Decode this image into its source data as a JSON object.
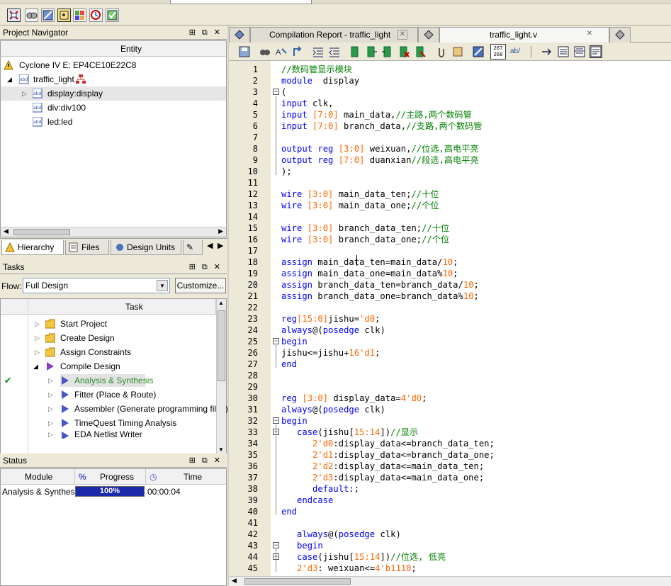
{
  "toolbar": {
    "icons": [
      "netlist-viewer-icon",
      "technology-map-icon",
      "chip-planner-icon",
      "pin-planner-icon",
      "design-assistant-icon",
      "timing-analyzer-icon",
      "programmer-icon"
    ]
  },
  "navigator": {
    "title": "Project Navigator",
    "column": "Entity",
    "device": "Cyclone IV E: EP4CE10E22C8",
    "items": [
      {
        "label": "traffic_light"
      },
      {
        "label": "display:display"
      },
      {
        "label": "div:div100"
      },
      {
        "label": "led:led"
      }
    ],
    "tabs": [
      "Hierarchy",
      "Files",
      "Design Units"
    ]
  },
  "tasks": {
    "title": "Tasks",
    "flow_label": "Flow:",
    "flow_value": "Full Design",
    "customize": "Customize...",
    "column": "Task",
    "items": [
      {
        "label": "Start Project"
      },
      {
        "label": "Create Design"
      },
      {
        "label": "Assign Constraints"
      },
      {
        "label": "Compile Design"
      },
      {
        "label": "Analysis & Synthesis"
      },
      {
        "label": "Fitter (Place & Route)"
      },
      {
        "label": "Assembler (Generate programming files)"
      },
      {
        "label": "TimeQuest Timing Analysis"
      },
      {
        "label": "EDA Netlist Writer"
      }
    ]
  },
  "status": {
    "title": "Status",
    "columns": {
      "module": "Module",
      "pct": "%",
      "progress": "Progress",
      "time": "Time"
    },
    "row": {
      "module": "Analysis & Synthesis",
      "progress_text": "100%",
      "progress": 1.0,
      "time": "00:00:04"
    }
  },
  "editor": {
    "tabs": [
      {
        "label": "Compilation Report - traffic_light"
      },
      {
        "label": "traffic_light.v"
      }
    ],
    "badge_top": "267",
    "badge_bottom": "268",
    "abc": "ab/"
  },
  "code": [
    {
      "n": "1",
      "t": [
        [
          "cm",
          "//数码管显示模块"
        ]
      ]
    },
    {
      "n": "2",
      "t": [
        [
          "kw",
          "module"
        ],
        [
          "",
          "  display"
        ]
      ]
    },
    {
      "n": "3",
      "t": [
        [
          "",
          "("
        ]
      ]
    },
    {
      "n": "4",
      "t": [
        [
          "kw",
          "input"
        ],
        [
          "",
          " clk,"
        ]
      ]
    },
    {
      "n": "5",
      "t": [
        [
          "kw",
          "input"
        ],
        [
          "",
          " "
        ],
        [
          "num",
          "[7:0]"
        ],
        [
          "",
          " main_data,"
        ],
        [
          "cm",
          "//主路,两个数码管"
        ]
      ]
    },
    {
      "n": "6",
      "t": [
        [
          "kw",
          "input"
        ],
        [
          "",
          " "
        ],
        [
          "num",
          "[7:0]"
        ],
        [
          "",
          " branch_data,"
        ],
        [
          "cm",
          "//支路,两个数码管"
        ]
      ]
    },
    {
      "n": "7",
      "t": []
    },
    {
      "n": "8",
      "t": [
        [
          "kw",
          "output reg"
        ],
        [
          "",
          " "
        ],
        [
          "num",
          "[3:0]"
        ],
        [
          "",
          " weixuan,"
        ],
        [
          "cm",
          "//位选,高电平亮"
        ]
      ]
    },
    {
      "n": "9",
      "t": [
        [
          "kw",
          "output reg"
        ],
        [
          "",
          " "
        ],
        [
          "num",
          "[7:0]"
        ],
        [
          "",
          " duanxian"
        ],
        [
          "cm",
          "//段选,高电平亮"
        ]
      ]
    },
    {
      "n": "10",
      "t": [
        [
          "",
          ");"
        ]
      ]
    },
    {
      "n": "11",
      "t": []
    },
    {
      "n": "12",
      "t": [
        [
          "kw",
          "wire"
        ],
        [
          "",
          " "
        ],
        [
          "num",
          "[3:0]"
        ],
        [
          "",
          " main_data_ten;"
        ],
        [
          "cm",
          "//十位"
        ]
      ]
    },
    {
      "n": "13",
      "t": [
        [
          "kw",
          "wire"
        ],
        [
          "",
          " "
        ],
        [
          "num",
          "[3:0]"
        ],
        [
          "",
          " main_data_one;"
        ],
        [
          "cm",
          "//个位"
        ]
      ]
    },
    {
      "n": "14",
      "t": []
    },
    {
      "n": "15",
      "t": [
        [
          "kw",
          "wire"
        ],
        [
          "",
          " "
        ],
        [
          "num",
          "[3:0]"
        ],
        [
          "",
          " branch_data_ten;"
        ],
        [
          "cm",
          "//十位"
        ]
      ]
    },
    {
      "n": "16",
      "t": [
        [
          "kw",
          "wire"
        ],
        [
          "",
          " "
        ],
        [
          "num",
          "[3:0]"
        ],
        [
          "",
          " branch_data_one;"
        ],
        [
          "cm",
          "//个位"
        ]
      ]
    },
    {
      "n": "17",
      "t": []
    },
    {
      "n": "18",
      "t": [
        [
          "kw",
          "assign"
        ],
        [
          "",
          " main_data_ten=main_data/"
        ],
        [
          "num",
          "10"
        ],
        [
          "",
          ";"
        ]
      ]
    },
    {
      "n": "19",
      "t": [
        [
          "kw",
          "assign"
        ],
        [
          "",
          " main_data_one=main_data%"
        ],
        [
          "num",
          "10"
        ],
        [
          "",
          ";"
        ]
      ]
    },
    {
      "n": "20",
      "t": [
        [
          "kw",
          "assign"
        ],
        [
          "",
          " branch_data_ten=branch_data/"
        ],
        [
          "num",
          "10"
        ],
        [
          "",
          ";"
        ]
      ]
    },
    {
      "n": "21",
      "t": [
        [
          "kw",
          "assign"
        ],
        [
          "",
          " branch_data_one=branch_data%"
        ],
        [
          "num",
          "10"
        ],
        [
          "",
          ";"
        ]
      ]
    },
    {
      "n": "22",
      "t": []
    },
    {
      "n": "23",
      "t": [
        [
          "kw",
          "reg"
        ],
        [
          "num",
          "[15:0]"
        ],
        [
          "",
          "jishu="
        ],
        [
          "num",
          "'d0"
        ],
        [
          "",
          ";"
        ]
      ]
    },
    {
      "n": "24",
      "t": [
        [
          "kw",
          "always"
        ],
        [
          "",
          "@("
        ],
        [
          "kw",
          "posedge"
        ],
        [
          "",
          " clk)"
        ]
      ]
    },
    {
      "n": "25",
      "t": [
        [
          "kw",
          "begin"
        ]
      ]
    },
    {
      "n": "26",
      "t": [
        [
          "",
          "jishu<=jishu+"
        ],
        [
          "num",
          "16'd1"
        ],
        [
          "",
          ";"
        ]
      ]
    },
    {
      "n": "27",
      "t": [
        [
          "kw",
          "end"
        ]
      ]
    },
    {
      "n": "28",
      "t": []
    },
    {
      "n": "29",
      "t": []
    },
    {
      "n": "30",
      "t": [
        [
          "kw",
          "reg"
        ],
        [
          "",
          " "
        ],
        [
          "num",
          "[3:0]"
        ],
        [
          "",
          " display_data="
        ],
        [
          "num",
          "4'd0"
        ],
        [
          "",
          ";"
        ]
      ]
    },
    {
      "n": "31",
      "t": [
        [
          "kw",
          "always"
        ],
        [
          "",
          "@("
        ],
        [
          "kw",
          "posedge"
        ],
        [
          "",
          " clk)"
        ]
      ]
    },
    {
      "n": "32",
      "t": [
        [
          "kw",
          "begin"
        ]
      ]
    },
    {
      "n": "33",
      "t": [
        [
          "",
          "   "
        ],
        [
          "kw",
          "case"
        ],
        [
          "",
          "(jishu["
        ],
        [
          "num",
          "15:14"
        ],
        [
          "",
          "])"
        ],
        [
          "cm",
          "//显示"
        ]
      ]
    },
    {
      "n": "34",
      "t": [
        [
          "",
          "      "
        ],
        [
          "num",
          "2'd0"
        ],
        [
          "",
          ":display_data<=branch_data_ten;"
        ]
      ]
    },
    {
      "n": "35",
      "t": [
        [
          "",
          "      "
        ],
        [
          "num",
          "2'd1"
        ],
        [
          "",
          ":display_data<=branch_data_one;"
        ]
      ]
    },
    {
      "n": "36",
      "t": [
        [
          "",
          "      "
        ],
        [
          "num",
          "2'd2"
        ],
        [
          "",
          ":display_data<=main_data_ten;"
        ]
      ]
    },
    {
      "n": "37",
      "t": [
        [
          "",
          "      "
        ],
        [
          "num",
          "2'd3"
        ],
        [
          "",
          ":display_data<=main_data_one;"
        ]
      ]
    },
    {
      "n": "38",
      "t": [
        [
          "",
          "      "
        ],
        [
          "kw",
          "default"
        ],
        [
          "",
          ":;"
        ]
      ]
    },
    {
      "n": "39",
      "t": [
        [
          "",
          "   "
        ],
        [
          "kw",
          "endcase"
        ]
      ]
    },
    {
      "n": "40",
      "t": [
        [
          "kw",
          "end"
        ]
      ]
    },
    {
      "n": "41",
      "t": []
    },
    {
      "n": "42",
      "t": [
        [
          "",
          "   "
        ],
        [
          "kw",
          "always"
        ],
        [
          "",
          "@("
        ],
        [
          "kw",
          "posedge"
        ],
        [
          "",
          " clk)"
        ]
      ]
    },
    {
      "n": "43",
      "t": [
        [
          "",
          "   "
        ],
        [
          "kw",
          "begin"
        ]
      ]
    },
    {
      "n": "44",
      "t": [
        [
          "",
          "   "
        ],
        [
          "kw",
          "case"
        ],
        [
          "",
          "(jishu["
        ],
        [
          "num",
          "15:14"
        ],
        [
          "",
          "])"
        ],
        [
          "cm",
          "//位选, 低亮"
        ]
      ]
    },
    {
      "n": "45",
      "t": [
        [
          "",
          "   "
        ],
        [
          "num",
          "2'd3"
        ],
        [
          "",
          ": weixuan<="
        ],
        [
          "num",
          "4'b1110"
        ],
        [
          "",
          ";"
        ]
      ]
    }
  ]
}
